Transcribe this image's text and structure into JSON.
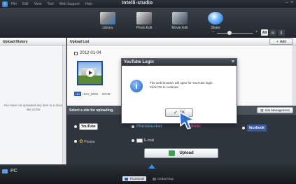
{
  "window": {
    "title": "Intelli-studio",
    "menu": [
      "File",
      "Edit",
      "View",
      "Tool",
      "Web Support",
      "Help"
    ],
    "controls": [
      "–",
      "×"
    ]
  },
  "toolbar": {
    "tools": [
      {
        "label": "Library",
        "icon": "library-icon"
      },
      {
        "label": "Photo Edit",
        "icon": "photo-edit-icon"
      },
      {
        "label": "Movie Edit",
        "icon": "movie-edit-icon"
      },
      {
        "label": "Share",
        "icon": "share-icon",
        "active": true
      }
    ],
    "zoom_minus": "−",
    "zoom_plus": "+",
    "view_buttons": [
      "All",
      "▭",
      "▯"
    ]
  },
  "left_panel": {
    "header": "Upload History",
    "empty_message": "You have not uploaded any item to a share site so far."
  },
  "upload_list": {
    "header": "Upload List",
    "add_label": "Add",
    "date": "2012-01-04",
    "file": {
      "badge": "HD",
      "name": "HDV_0005",
      "duration": "00:09"
    }
  },
  "sites": {
    "header": "Select a site for uploading.",
    "manage_label": "Site Management",
    "items": [
      {
        "name": "YouTube",
        "row": 1
      },
      {
        "name": "Photobucket",
        "row": 1
      },
      {
        "name": "flickr",
        "row": 1
      },
      {
        "name": "facebook",
        "row": 1
      },
      {
        "name": "Picasa",
        "row": 2
      },
      {
        "name": "E-mail",
        "row": 2
      }
    ],
    "upload_label": "Upload"
  },
  "dialog": {
    "title": "YouTube Login",
    "close": "×",
    "message_line1": "The web browser will open for YouTube login.",
    "message_line2": "Click OK to continue.",
    "ok_label": "OK"
  },
  "statusbar": {
    "pc_label": "PC",
    "tabs": [
      {
        "label": "Thumbnail",
        "selected": true
      },
      {
        "label": "Global Map",
        "selected": false
      }
    ]
  }
}
